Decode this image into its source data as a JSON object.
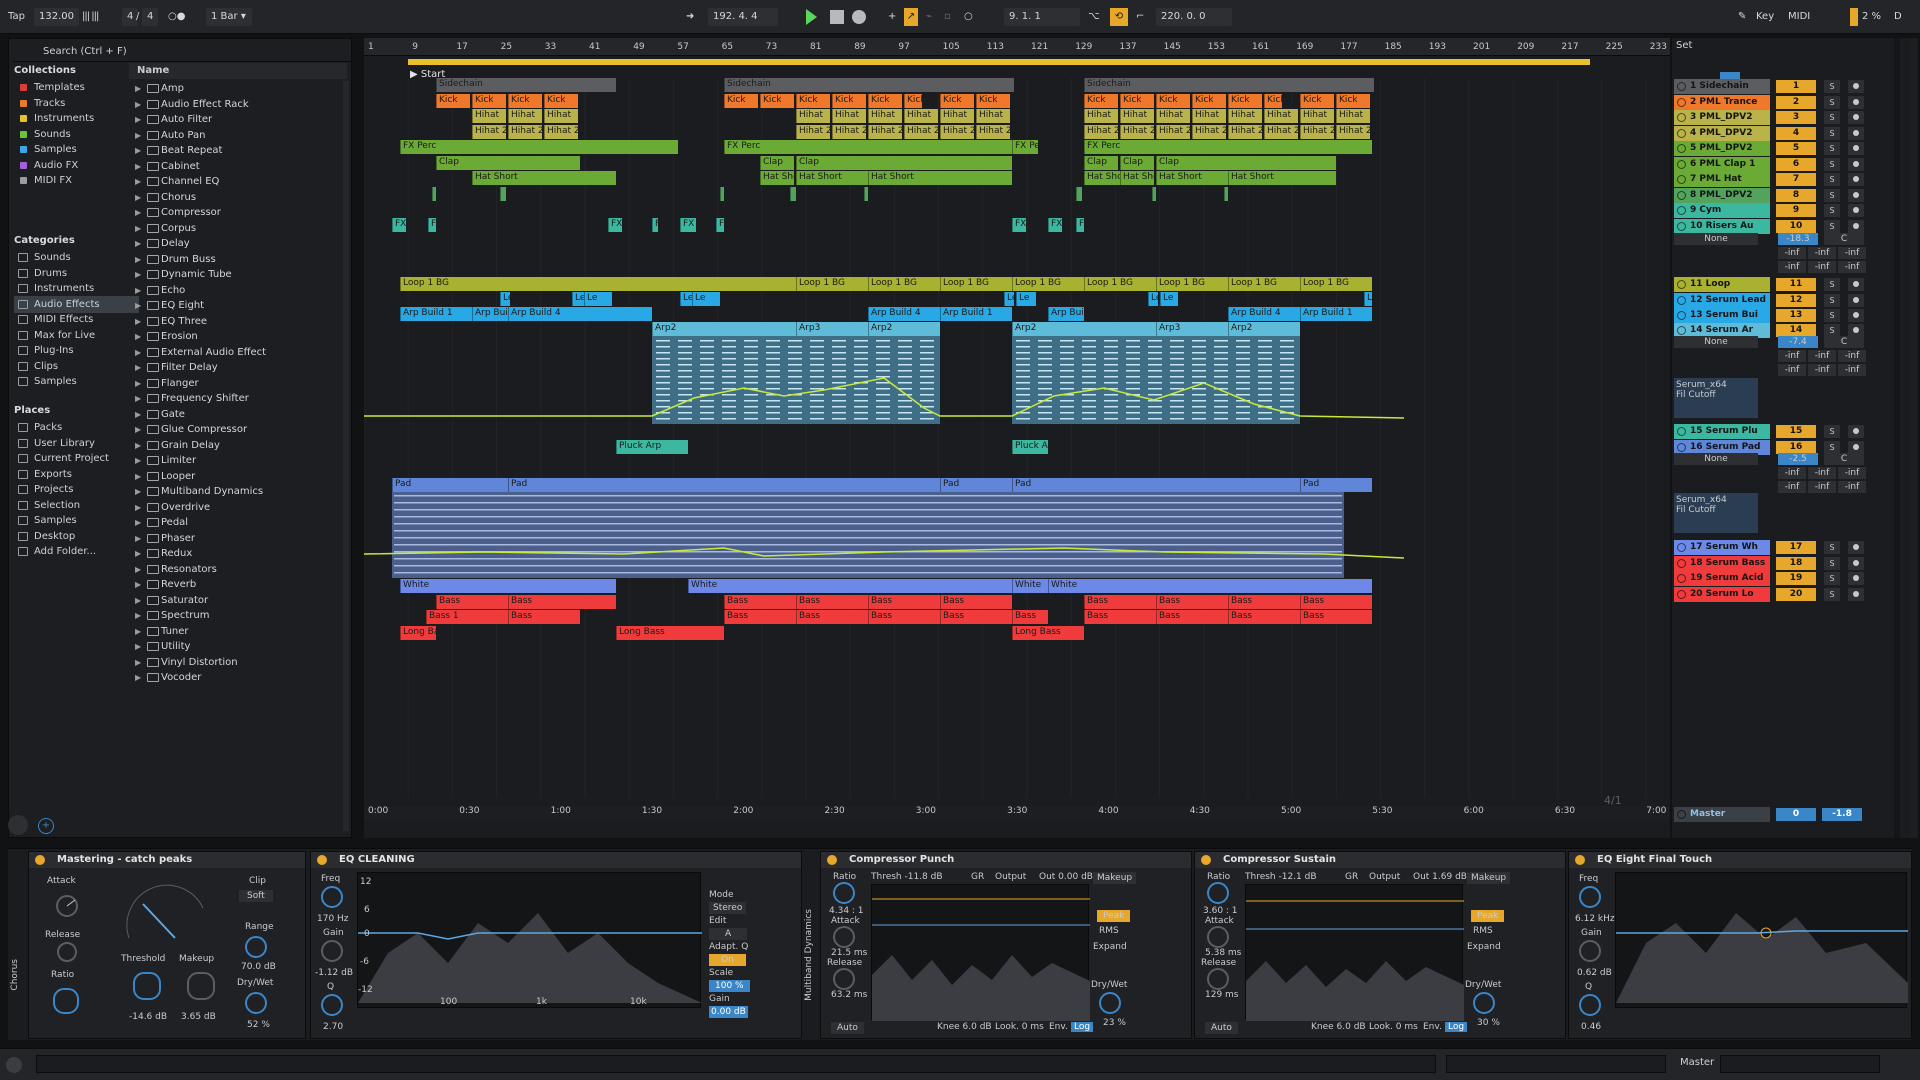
{
  "transport": {
    "tap": "Tap",
    "tempo": "132.00",
    "sig_num": "4",
    "sig_den": "4",
    "quant": "1 Bar",
    "position": "192.  4.  4",
    "loop_start": "9.  1.  1",
    "loop_length": "220.  0.  0",
    "key": "Key",
    "midi": "MIDI",
    "cpu": "2 %",
    "d": "D"
  },
  "browser": {
    "search": "Search (Ctrl + F)",
    "col_header": "Name",
    "collections_title": "Collections",
    "collections": [
      {
        "label": "Templates",
        "color": "#e03b3b"
      },
      {
        "label": "Tracks",
        "color": "#e87a2a"
      },
      {
        "label": "Instruments",
        "color": "#e8c22a"
      },
      {
        "label": "Sounds",
        "color": "#6fc13a"
      },
      {
        "label": "Samples",
        "color": "#3aa8e8"
      },
      {
        "label": "Audio FX",
        "color": "#a35fe0"
      },
      {
        "label": "MIDI FX",
        "color": "#9a9ca0"
      }
    ],
    "categories_title": "Categories",
    "categories": [
      "Sounds",
      "Drums",
      "Instruments",
      "Audio Effects",
      "MIDI Effects",
      "Max for Live",
      "Plug-Ins",
      "Clips",
      "Samples"
    ],
    "places_title": "Places",
    "places": [
      "Packs",
      "User Library",
      "Current Project",
      "Exports",
      "Projects",
      "Selection",
      "Samples",
      "Desktop",
      "Add Folder..."
    ],
    "items": [
      "Amp",
      "Audio Effect Rack",
      "Auto Filter",
      "Auto Pan",
      "Beat Repeat",
      "Cabinet",
      "Channel EQ",
      "Chorus",
      "Compressor",
      "Corpus",
      "Delay",
      "Drum Buss",
      "Dynamic Tube",
      "Echo",
      "EQ Eight",
      "EQ Three",
      "Erosion",
      "External Audio Effect",
      "Filter Delay",
      "Flanger",
      "Frequency Shifter",
      "Gate",
      "Glue Compressor",
      "Grain Delay",
      "Limiter",
      "Looper",
      "Multiband Dynamics",
      "Overdrive",
      "Pedal",
      "Phaser",
      "Redux",
      "Resonators",
      "Reverb",
      "Saturator",
      "Spectrum",
      "Tuner",
      "Utility",
      "Vinyl Distortion",
      "Vocoder"
    ]
  },
  "ruler": [
    "1",
    "9",
    "17",
    "25",
    "33",
    "41",
    "49",
    "57",
    "65",
    "73",
    "81",
    "89",
    "97",
    "105",
    "113",
    "121",
    "129",
    "137",
    "145",
    "153",
    "161",
    "169",
    "177",
    "185",
    "193",
    "201",
    "209",
    "217",
    "225",
    "233"
  ],
  "timeline": [
    "0:00",
    "0:30",
    "1:00",
    "1:30",
    "2:00",
    "2:30",
    "3:00",
    "3:30",
    "4:00",
    "4:30",
    "5:00",
    "5:30",
    "6:00",
    "6:30",
    "7:00"
  ],
  "locator": "Start",
  "set_label": "Set",
  "page_count": "4/1",
  "tracks": [
    {
      "name": "1 Sidechain",
      "num": "1",
      "color": "#5b5d61"
    },
    {
      "name": "2 PML Trance",
      "num": "2",
      "color": "#f0782a"
    },
    {
      "name": "3 PML_DPV2",
      "num": "3",
      "color": "#b9b349"
    },
    {
      "name": "4 PML_DPV2",
      "num": "4",
      "color": "#b9b349"
    },
    {
      "name": "5 PML_DPV2",
      "num": "5",
      "color": "#6aaa35"
    },
    {
      "name": "6 PML Clap 1",
      "num": "6",
      "color": "#6aaa35"
    },
    {
      "name": "7 PML Hat",
      "num": "7",
      "color": "#6aaa35"
    },
    {
      "name": "8 PML_DPV2",
      "num": "8",
      "color": "#53a35c"
    },
    {
      "name": "9 Cym",
      "num": "9",
      "color": "#3cb8a0"
    },
    {
      "name": "10 Risers Au",
      "num": "10",
      "color": "#3cb8a0"
    },
    {
      "name": "11 Loop",
      "num": "11",
      "color": "#a8b130"
    },
    {
      "name": "12 Serum Lead",
      "num": "12",
      "color": "#28a9e6"
    },
    {
      "name": "13 Serum Bui",
      "num": "13",
      "color": "#28a9e6"
    },
    {
      "name": "14 Serum Ar",
      "num": "14",
      "color": "#5fbcd8"
    },
    {
      "name": "15 Serum Plu",
      "num": "15",
      "color": "#3cb8a0"
    },
    {
      "name": "16 Serum Pad",
      "num": "16",
      "color": "#5f86d8"
    },
    {
      "name": "17 Serum Wh",
      "num": "17",
      "color": "#6c89e8"
    },
    {
      "name": "18 Serum Bass",
      "num": "18",
      "color": "#ef3b3b"
    },
    {
      "name": "19 Serum Acid",
      "num": "19",
      "color": "#ef3b3b"
    },
    {
      "name": "20 Serum Lo",
      "num": "20",
      "color": "#ef3b3b"
    }
  ],
  "track_extras": {
    "risers_vol": "-18.3",
    "center": "C",
    "none": "None",
    "inf": "-inf",
    "arp_vol": "-7.4",
    "pad_vol": "-2.5",
    "serum": "Serum_x64",
    "fil_cutoff": "Fil Cutoff"
  },
  "master": {
    "name": "Master",
    "num": "0",
    "vol": "-1.8"
  },
  "clips": {
    "sidechain": "Sidechain",
    "kick": "Kick",
    "hihat": "Hihat",
    "hihat2": "Hihat 2",
    "fxperc": "FX Perc",
    "clap": "Clap",
    "hatshort": "Hat Short",
    "fx": "FX",
    "loop": "Loop 1 BG",
    "lead": "Le",
    "lead2": "Lead",
    "arp1": "Arp Build 1",
    "arp4": "Arp Build 4",
    "arp2": "Arp2",
    "arp3": "Arp3",
    "pluck": "Pluck Arp",
    "pad": "Pad",
    "white": "White",
    "bass": "Bass",
    "bass1": "Bass 1",
    "longbass": "Long Bass"
  },
  "devices": {
    "mastering": {
      "title": "Mastering - catch peaks",
      "attack": "Attack",
      "release": "Release",
      "ratio": "Ratio",
      "threshold": "Threshold",
      "threshold_val": "-14.6 dB",
      "makeup": "Makeup",
      "makeup_val": "3.65 dB",
      "clip": "Clip",
      "soft": "Soft",
      "range": "Range",
      "range_val": "70.0 dB",
      "drywet": "Dry/Wet",
      "drywet_val": "52 %",
      "chorus": "Chorus"
    },
    "eq": {
      "title": "EQ CLEANING",
      "freq": "Freq",
      "freq_val": "170 Hz",
      "gain": "Gain",
      "gain_val": "-1.12 dB",
      "q": "Q",
      "q_val": "2.70",
      "mode": "Mode",
      "mode_val": "Stereo",
      "edit": "Edit",
      "edit_val": "A",
      "adapt": "Adapt. Q",
      "adapt_val": "On",
      "scale": "Scale",
      "scale_val": "100 %",
      "gain2": "Gain",
      "gain2_val": "0.00 dB",
      "db12": "12",
      "db6": "6",
      "db0": "0",
      "dbm6": "-6",
      "dbm12": "-12",
      "f100": "100",
      "f1k": "1k",
      "f10k": "10k"
    },
    "cp": {
      "title": "Compressor Punch",
      "ratio": "Ratio",
      "ratio_val": "4.34 : 1",
      "attack": "Attack",
      "attack_val": "21.5 ms",
      "release": "Release",
      "release_val": "63.2 ms",
      "auto": "Auto",
      "thresh": "Thresh -11.8 dB",
      "gr": "GR",
      "output": "Output",
      "out": "Out 0.00 dB",
      "makeup": "Makeup",
      "peak": "Peak",
      "rms": "RMS",
      "expand": "Expand",
      "drywet": "Dry/Wet",
      "drywet_val": "23 %",
      "knee": "Knee 6.0 dB",
      "look": "Look. 0 ms",
      "env": "Env.",
      "log": "Log",
      "md": "Multiband Dynamics"
    },
    "cs": {
      "title": "Compressor Sustain",
      "ratio": "Ratio",
      "ratio_val": "3.60 : 1",
      "attack": "Attack",
      "attack_val": "5.38 ms",
      "release": "Release",
      "release_val": "129 ms",
      "auto": "Auto",
      "thresh": "Thresh -12.1 dB",
      "gr": "GR",
      "output": "Output",
      "out": "Out 1.69 dB",
      "makeup": "Makeup",
      "peak": "Peak",
      "rms": "RMS",
      "expand": "Expand",
      "drywet": "Dry/Wet",
      "drywet_val": "30 %",
      "knee": "Knee 6.0 dB",
      "look": "Look. 0 ms",
      "env": "Env.",
      "log": "Log"
    },
    "eq8": {
      "title": "EQ Eight Final Touch",
      "freq": "Freq",
      "freq_val": "6.12 kHz",
      "gain": "Gain",
      "gain_val": "0.62 dB",
      "q": "Q",
      "q_val": "0.46"
    }
  },
  "status": {
    "master": "Master"
  }
}
